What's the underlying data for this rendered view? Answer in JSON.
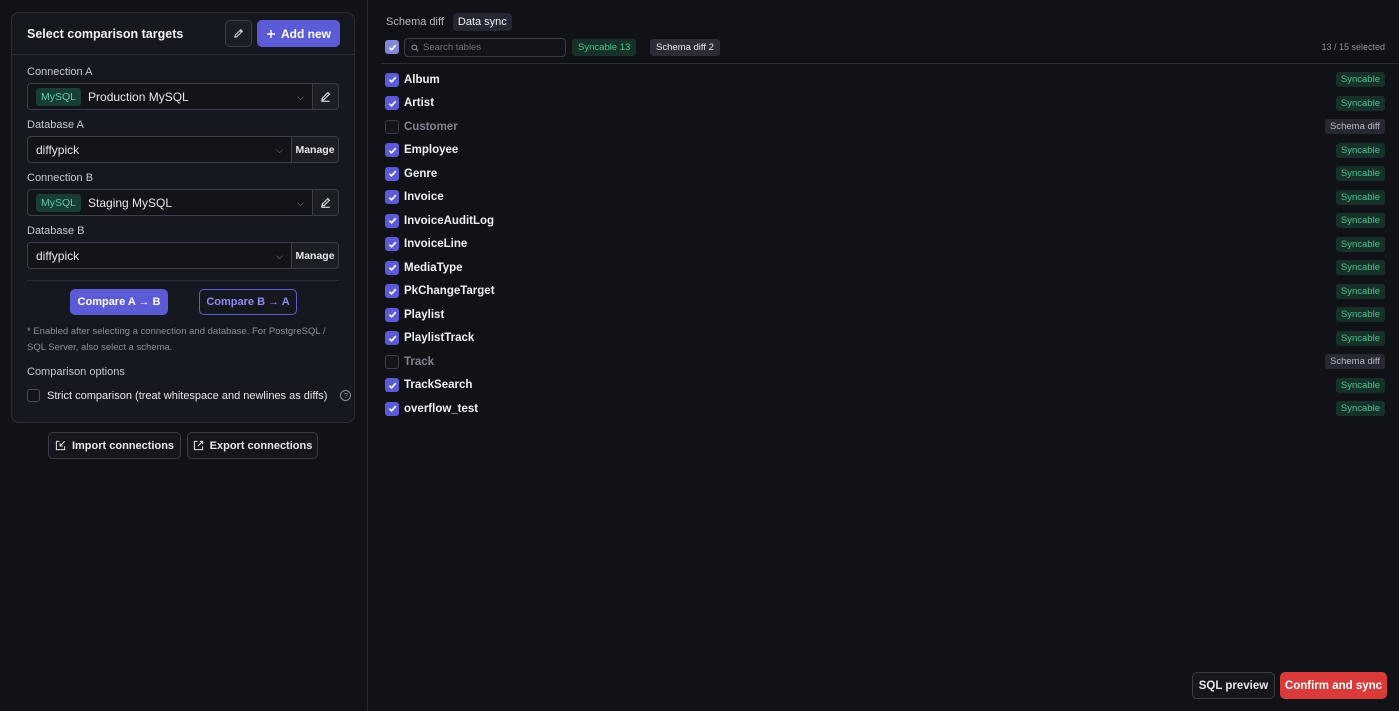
{
  "left": {
    "title": "Select comparison targets",
    "add_new_label": "Add new",
    "connection_a": {
      "label": "Connection A",
      "db_type": "MySQL",
      "value": "Production MySQL"
    },
    "database_a": {
      "label": "Database A",
      "value": "diffypick",
      "manage_label": "Manage"
    },
    "connection_b": {
      "label": "Connection B",
      "db_type": "MySQL",
      "value": "Staging MySQL"
    },
    "database_b": {
      "label": "Database B",
      "value": "diffypick",
      "manage_label": "Manage"
    },
    "compare_ab_label": "Compare A → B",
    "compare_ba_label": "Compare B → A",
    "note": "* Enabled after selecting a connection and database. For PostgreSQL / SQL Server, also select a schema.",
    "options_title": "Comparison options",
    "strict_label": "Strict comparison (treat whitespace and newlines as diffs)",
    "import_label": "Import connections",
    "export_label": "Export connections"
  },
  "right": {
    "tabs": [
      {
        "label": "Schema diff",
        "active": false
      },
      {
        "label": "Data sync",
        "active": true
      }
    ],
    "search_placeholder": "Search tables",
    "syncable_badge": "Syncable 13",
    "schema_diff_badge": "Schema diff 2",
    "selected_count": "13 / 15 selected",
    "tables": [
      {
        "name": "Album",
        "checked": true,
        "status": "Syncable"
      },
      {
        "name": "Artist",
        "checked": true,
        "status": "Syncable"
      },
      {
        "name": "Customer",
        "checked": false,
        "status": "Schema diff"
      },
      {
        "name": "Employee",
        "checked": true,
        "status": "Syncable"
      },
      {
        "name": "Genre",
        "checked": true,
        "status": "Syncable"
      },
      {
        "name": "Invoice",
        "checked": true,
        "status": "Syncable"
      },
      {
        "name": "InvoiceAuditLog",
        "checked": true,
        "status": "Syncable"
      },
      {
        "name": "InvoiceLine",
        "checked": true,
        "status": "Syncable"
      },
      {
        "name": "MediaType",
        "checked": true,
        "status": "Syncable"
      },
      {
        "name": "PkChangeTarget",
        "checked": true,
        "status": "Syncable"
      },
      {
        "name": "Playlist",
        "checked": true,
        "status": "Syncable"
      },
      {
        "name": "PlaylistTrack",
        "checked": true,
        "status": "Syncable"
      },
      {
        "name": "Track",
        "checked": false,
        "status": "Schema diff"
      },
      {
        "name": "TrackSearch",
        "checked": true,
        "status": "Syncable"
      },
      {
        "name": "overflow_test",
        "checked": true,
        "status": "Syncable"
      }
    ],
    "sql_preview_label": "SQL preview",
    "confirm_label": "Confirm and sync"
  },
  "colors": {
    "accent": "#5b5bd6",
    "syncable": "#4fc28f",
    "danger": "#d93a3a",
    "db_tag": "#5dc9a8"
  }
}
